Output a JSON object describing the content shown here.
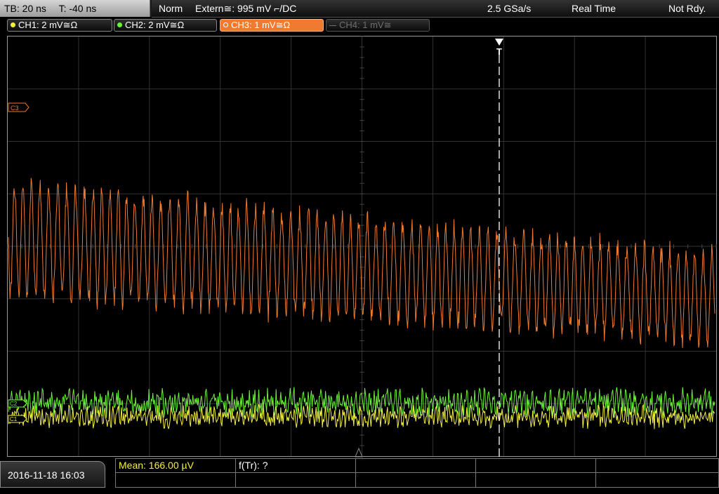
{
  "timebase": {
    "tb": "TB: 20 ns",
    "trigger_pos": "T: -40 ns"
  },
  "status": {
    "mode": "Norm",
    "trigger_src": "Extern≅: 995 mV ⌐/DC",
    "sample_rate": "2.5 GSa/s",
    "acq_mode": "Real Time",
    "state": "Not Rdy."
  },
  "channels": [
    {
      "label": "CH1: 2 mV≅Ω",
      "color": "#f4f040",
      "state": "on"
    },
    {
      "label": "CH2: 2 mV≅Ω",
      "color": "#6cf03a",
      "state": "on"
    },
    {
      "label": "CH3: 1 mV≅Ω",
      "color": "#f07a30",
      "state": "selected"
    },
    {
      "label": "CH4: 1 mV≅",
      "color": "#6e6e6e",
      "state": "off"
    }
  ],
  "markers": {
    "ch3": "C3",
    "ch2": "C2",
    "ch1": "C1",
    "trigger": "T"
  },
  "measurements": {
    "mean": "Mean: 166.00 µV",
    "freq": "f(Tr): ?"
  },
  "datetime": "2016-11-18 16:03",
  "colors": {
    "ch1": "#f4f040",
    "ch2": "#6cf03a",
    "ch3": "#f07a30",
    "grid": "#3a3a3a"
  }
}
